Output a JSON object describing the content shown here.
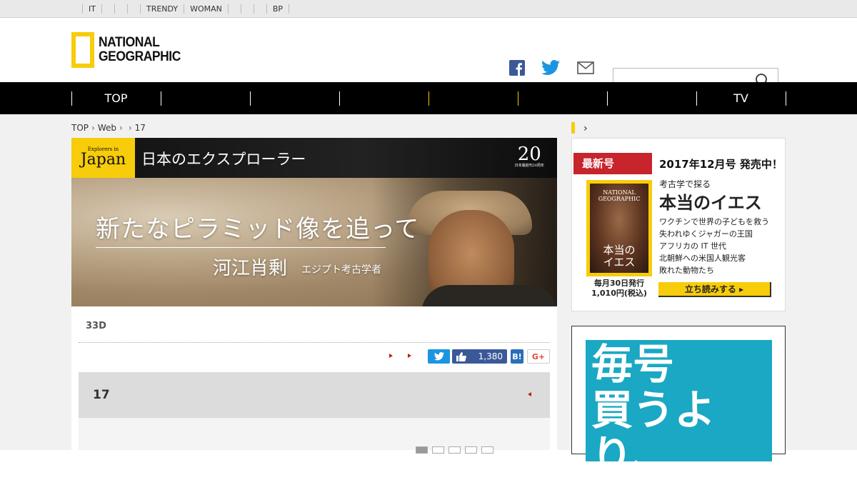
{
  "topbar": {
    "links": [
      "IT",
      "",
      "",
      "",
      "TRENDY",
      "WOMAN",
      "",
      "",
      "",
      "BP"
    ]
  },
  "logo": {
    "line1": "NATIONAL",
    "line2": "GEOGRAPHIC"
  },
  "nav": {
    "items": [
      "TOP",
      "",
      "",
      "",
      "",
      "",
      "",
      "TV"
    ]
  },
  "breadcrumb": {
    "items": [
      "TOP",
      "Web",
      "",
      "17"
    ]
  },
  "banner": {
    "series_small": "Explorers in",
    "series_big": "Japan",
    "header_title": "日本のエクスプローラー",
    "anniv": "20",
    "anniv_sub": "日本版創刊20周年",
    "headline": "新たなピラミッド像を追って",
    "person": "河江肖剰",
    "role": "エジプト考古学者"
  },
  "article": {
    "tag": "33D",
    "like_count": "1,380",
    "section_title": "17"
  },
  "sidebar": {
    "new_issue": "最新号",
    "issue_date": "2017年12月号 発売中！",
    "cover_brand1": "NATIONAL",
    "cover_brand2": "GEOGRAPHIC",
    "cover_title": "本当の\nイエス",
    "kicker": "考古学で探る",
    "feature": "本当のイエス",
    "stories": [
      "ワクチンで世界の子どもを救う",
      "失われゆくジャガーの王国",
      "アフリカの IT 世代",
      "北朝鮮への米国人観光客",
      "敗れた動物たち"
    ],
    "publish": "毎月30日発行",
    "price": "1,010円(税込)",
    "read_button": "立ち読みする ▸",
    "ad_text": "毎号\n買うより、"
  },
  "colors": {
    "brand_yellow": "#f7cc0a",
    "nav_bg": "#000000",
    "twitter": "#1b95e0",
    "facebook": "#3b5998",
    "red": "#c8242c"
  }
}
